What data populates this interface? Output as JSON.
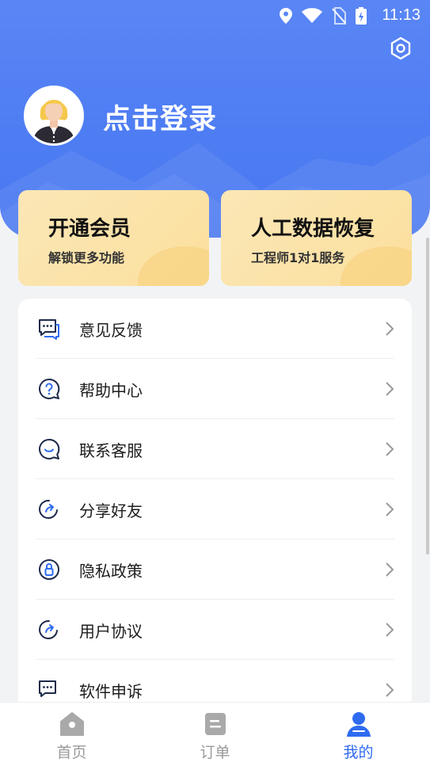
{
  "status_bar": {
    "time": "11:13"
  },
  "header": {
    "login_text": "点击登录"
  },
  "cards": [
    {
      "title": "开通会员",
      "subtitle": "解锁更多功能"
    },
    {
      "title": "人工数据恢复",
      "subtitle": "工程师1对1服务"
    }
  ],
  "menu": {
    "items": [
      {
        "label": "意见反馈",
        "icon": "feedback-icon"
      },
      {
        "label": "帮助中心",
        "icon": "help-icon"
      },
      {
        "label": "联系客服",
        "icon": "customer-service-icon"
      },
      {
        "label": "分享好友",
        "icon": "share-icon"
      },
      {
        "label": "隐私政策",
        "icon": "privacy-icon"
      },
      {
        "label": "用户协议",
        "icon": "agreement-icon"
      },
      {
        "label": "软件申诉",
        "icon": "appeal-icon"
      }
    ]
  },
  "tabbar": {
    "tabs": [
      {
        "label": "首页",
        "icon": "home-icon",
        "active": false
      },
      {
        "label": "订单",
        "icon": "order-icon",
        "active": false
      },
      {
        "label": "我的",
        "icon": "profile-icon",
        "active": true
      }
    ]
  },
  "colors": {
    "primary": "#4d7cf3",
    "accent": "#2e6bf0",
    "card": "#fbe3a8"
  }
}
